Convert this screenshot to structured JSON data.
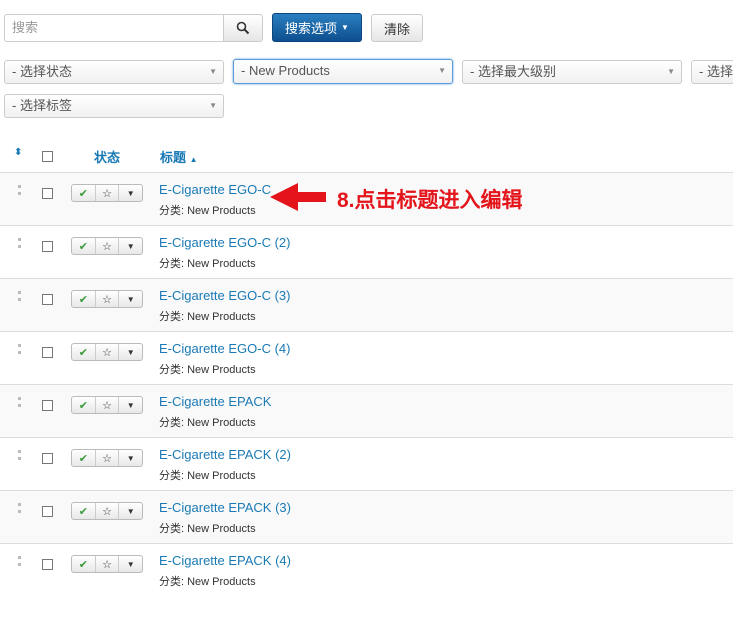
{
  "toolbar": {
    "search_placeholder": "搜索",
    "search_options": "搜索选项",
    "clear": "清除"
  },
  "filters": [
    "- 选择状态",
    "- New Products",
    "- 选择最大级别",
    "- 选择",
    "- 选择标签"
  ],
  "table": {
    "headers": {
      "status": "状态",
      "title": "标题"
    },
    "rows": [
      {
        "title": "E-Cigarette EGO-C",
        "category": "分类: New Products"
      },
      {
        "title": "E-Cigarette EGO-C (2)",
        "category": "分类: New Products"
      },
      {
        "title": "E-Cigarette EGO-C (3)",
        "category": "分类: New Products"
      },
      {
        "title": "E-Cigarette EGO-C (4)",
        "category": "分类: New Products"
      },
      {
        "title": "E-Cigarette EPACK",
        "category": "分类: New Products"
      },
      {
        "title": "E-Cigarette EPACK (2)",
        "category": "分类: New Products"
      },
      {
        "title": "E-Cigarette EPACK (3)",
        "category": "分类: New Products"
      },
      {
        "title": "E-Cigarette EPACK (4)",
        "category": "分类: New Products"
      }
    ]
  },
  "annotation": "8.点击标题进入编辑",
  "colors": {
    "primary": "#1a5fa0",
    "link": "#1a7ab5",
    "annotation": "#e3141a",
    "published": "#3c9a3c"
  }
}
